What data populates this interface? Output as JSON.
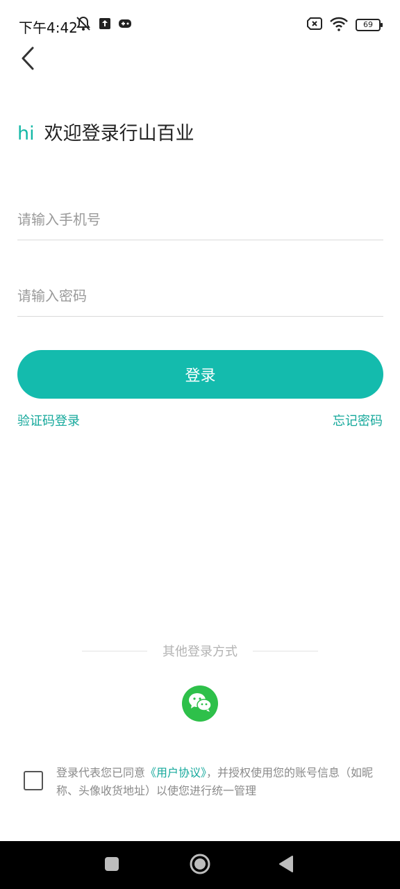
{
  "status_bar": {
    "time": "下午4:42",
    "battery": "69",
    "icons": [
      "bell-off-icon",
      "upload-icon",
      "gamepad-icon",
      "no-sim-icon",
      "wifi-icon",
      "battery-icon"
    ]
  },
  "header": {
    "back_icon": "chevron-left-icon"
  },
  "greeting": {
    "hi": "hi",
    "text": "欢迎登录行山百业"
  },
  "form": {
    "phone_placeholder": "请输入手机号",
    "phone_value": "",
    "password_placeholder": "请输入密码",
    "password_value": "",
    "login_label": "登录",
    "sms_login_label": "验证码登录",
    "forgot_password_label": "忘记密码"
  },
  "other_login": {
    "label": "其他登录方式",
    "wechat_icon": "wechat-icon"
  },
  "agreement": {
    "checked": false,
    "prefix": "登录代表您已同意",
    "link": "《用户协议》",
    "suffix": "，并授权使用您的账号信息（如昵称、头像收货地址）以使您进行统一管理"
  },
  "colors": {
    "accent": "#14bbad",
    "wechat": "#2ec04a"
  }
}
